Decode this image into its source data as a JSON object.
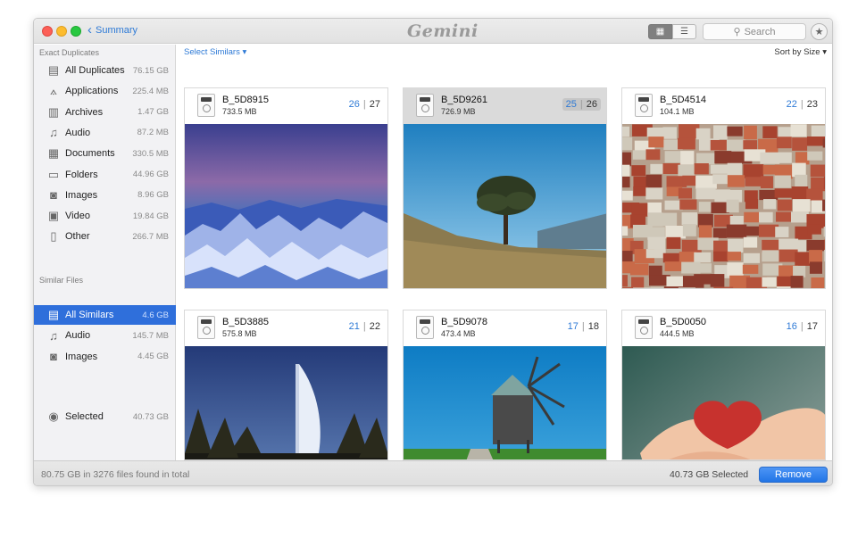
{
  "titlebar": {
    "back_label": "Summary",
    "logo": "Gemini",
    "search_placeholder": "Search"
  },
  "sidebar": {
    "exact_title": "Exact Duplicates",
    "exact_items": [
      {
        "label": "All Duplicates",
        "size": "76.15 GB",
        "icon": "drive-icon"
      },
      {
        "label": "Applications",
        "size": "225.4 MB",
        "icon": "applications-icon"
      },
      {
        "label": "Archives",
        "size": "1.47 GB",
        "icon": "archive-icon"
      },
      {
        "label": "Audio",
        "size": "87.2 MB",
        "icon": "music-note-icon"
      },
      {
        "label": "Documents",
        "size": "330.5 MB",
        "icon": "document-icon"
      },
      {
        "label": "Folders",
        "size": "44.96 GB",
        "icon": "folder-icon"
      },
      {
        "label": "Images",
        "size": "8.96 GB",
        "icon": "camera-icon"
      },
      {
        "label": "Video",
        "size": "19.84 GB",
        "icon": "film-icon"
      },
      {
        "label": "Other",
        "size": "266.7 MB",
        "icon": "file-icon"
      }
    ],
    "similar_title": "Similar Files",
    "similar_items": [
      {
        "label": "All Similars",
        "size": "4.6 GB",
        "icon": "drive-icon",
        "active": true
      },
      {
        "label": "Audio",
        "size": "145.7 MB",
        "icon": "music-note-icon"
      },
      {
        "label": "Images",
        "size": "4.45 GB",
        "icon": "camera-icon"
      }
    ],
    "selected": {
      "label": "Selected",
      "size": "40.73 GB",
      "icon": "check-circle-icon"
    }
  },
  "main": {
    "select_similars": "Select Similars ▾",
    "sort": "Sort by Size ▾",
    "cards": [
      {
        "name": "B_5D8915",
        "size": "733.5 MB",
        "selected_count": "26",
        "total": "27",
        "image": "mountains-photo"
      },
      {
        "name": "B_5D9261",
        "size": "726.9 MB",
        "selected_count": "25",
        "total": "26",
        "image": "tree-photo",
        "highlighted": true
      },
      {
        "name": "B_5D4514",
        "size": "104.1 MB",
        "selected_count": "22",
        "total": "23",
        "image": "city-photo"
      },
      {
        "name": "B_5D3885",
        "size": "575.8 MB",
        "selected_count": "21",
        "total": "22",
        "image": "burj-photo"
      },
      {
        "name": "B_5D9078",
        "size": "473.4 MB",
        "selected_count": "17",
        "total": "18",
        "image": "windmill-photo"
      },
      {
        "name": "B_5D0050",
        "size": "444.5 MB",
        "selected_count": "16",
        "total": "17",
        "image": "love-hands-photo"
      }
    ]
  },
  "footer": {
    "total": "80.75 GB in 3276 files found in total",
    "selected": "40.73 GB Selected",
    "remove": "Remove"
  },
  "colors": {
    "accent": "#2f6fdb",
    "count_blue": "#2e7ad6"
  }
}
